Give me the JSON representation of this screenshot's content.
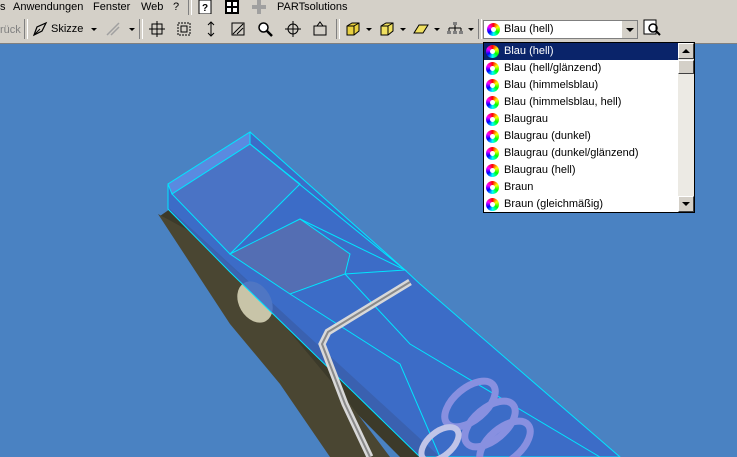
{
  "menu": [
    {
      "label": "Anwendungen",
      "key": "A"
    },
    {
      "label": "Fenster",
      "key": "F"
    },
    {
      "label": "Web",
      "key": "W"
    },
    {
      "label": "?",
      "key": "?"
    }
  ],
  "menu_partsolutions": "PARTsolutions",
  "toolbar": {
    "back_partial": "rück",
    "sketch_label": "Skizze"
  },
  "color_combo": {
    "selected": "Blau (hell)",
    "options": [
      "Blau (hell)",
      "Blau (hell/glänzend)",
      "Blau (himmelsblau)",
      "Blau (himmelsblau, hell)",
      "Blaugrau",
      "Blaugrau (dunkel)",
      "Blaugrau (dunkel/glänzend)",
      "Blaugrau (hell)",
      "Braun",
      "Braun (gleichmäßig)"
    ]
  },
  "colors": {
    "viewport_bg": "#4a82c2",
    "selection": "#0a246a",
    "edge_highlight": "#00e5ff"
  }
}
